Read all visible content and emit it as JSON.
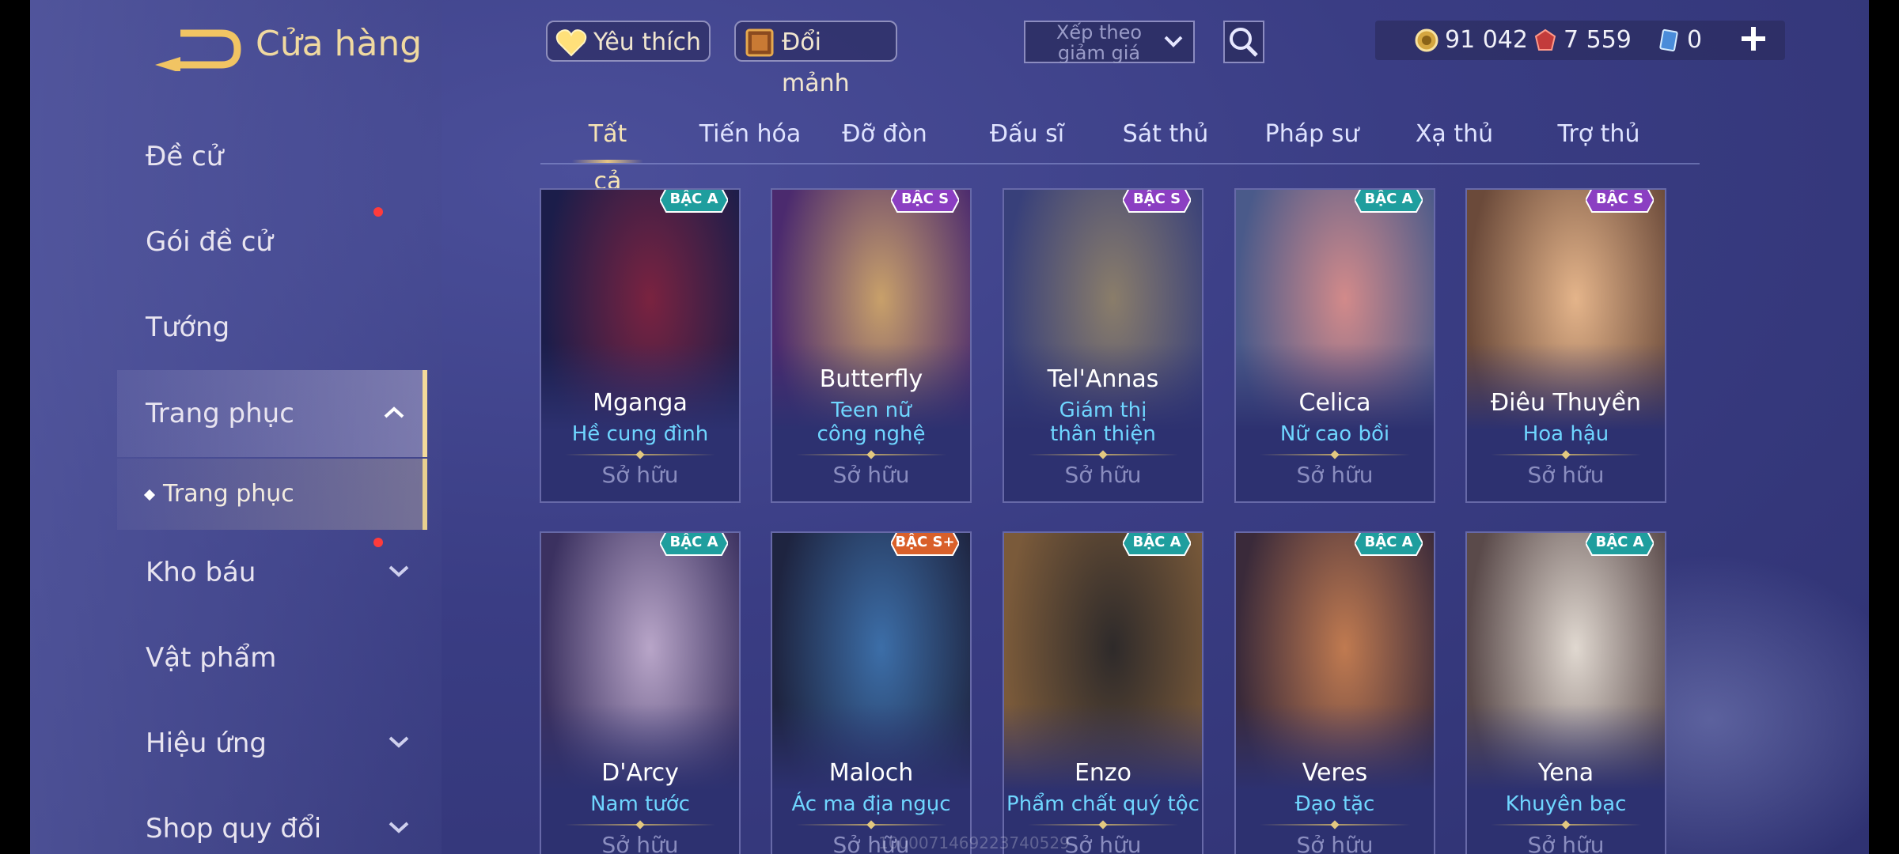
{
  "header": {
    "title": "Cửa hàng",
    "favorites_label": "Yêu thích",
    "exchange_label": "Đổi mảnh",
    "sort_label": "Xếp theo giảm giá"
  },
  "currency": {
    "gold": "91 042",
    "gems": "7 559",
    "vouchers": "0"
  },
  "sidebar": {
    "items": [
      {
        "label": "Đề cử"
      },
      {
        "label": "Gói đề cử"
      },
      {
        "label": "Tướng"
      },
      {
        "label": "Trang phục"
      },
      {
        "label": "Kho báu"
      },
      {
        "label": "Vật phẩm"
      },
      {
        "label": "Hiệu ứng"
      },
      {
        "label": "Shop quy đổi"
      }
    ],
    "subitem": "Trang phục"
  },
  "tabs": [
    "Tất cả",
    "Tiến hóa",
    "Đỡ đòn",
    "Đấu sĩ",
    "Sát thủ",
    "Pháp sư",
    "Xạ thủ",
    "Trợ thủ"
  ],
  "cards": [
    {
      "name": "Mganga",
      "skin": "Hề cung đình",
      "rank": "BẬC A",
      "status": "Sở hữu"
    },
    {
      "name": "Butterfly",
      "skin": "Teen nữ công nghệ",
      "rank": "BẬC S",
      "status": "Sở hữu"
    },
    {
      "name": "Tel'Annas",
      "skin": "Giám thị thân thiện",
      "rank": "BẬC S",
      "status": "Sở hữu"
    },
    {
      "name": "Celica",
      "skin": "Nữ cao bồi",
      "rank": "BẬC A",
      "status": "Sở hữu"
    },
    {
      "name": "Điêu Thuyền",
      "skin": "Hoa hậu",
      "rank": "BẬC S",
      "status": "Sở hữu"
    },
    {
      "name": "D'Arcy",
      "skin": "Nam tước",
      "rank": "BẬC A",
      "status": "Sở hữu"
    },
    {
      "name": "Maloch",
      "skin": "Ác ma địa ngục",
      "rank": "BẬC S+",
      "status": "Sở hữu"
    },
    {
      "name": "Enzo",
      "skin": "Phẩm chất quý tộc",
      "rank": "BẬC A",
      "status": "Sở hữu"
    },
    {
      "name": "Veres",
      "skin": "Đạo tặc",
      "rank": "BẬC A",
      "status": "Sở hữu"
    },
    {
      "name": "Yena",
      "skin": "Khuyên bạc",
      "rank": "BẬC A",
      "status": "Sở hữu"
    }
  ],
  "watermark": "1000071469223740529",
  "colors": {
    "accent": "#f0d9a0",
    "skin_text": "#6fd6ff",
    "badge_a": "#1f9e9e",
    "badge_s": "#8b3fc2",
    "badge_splus": "#d9602a"
  }
}
